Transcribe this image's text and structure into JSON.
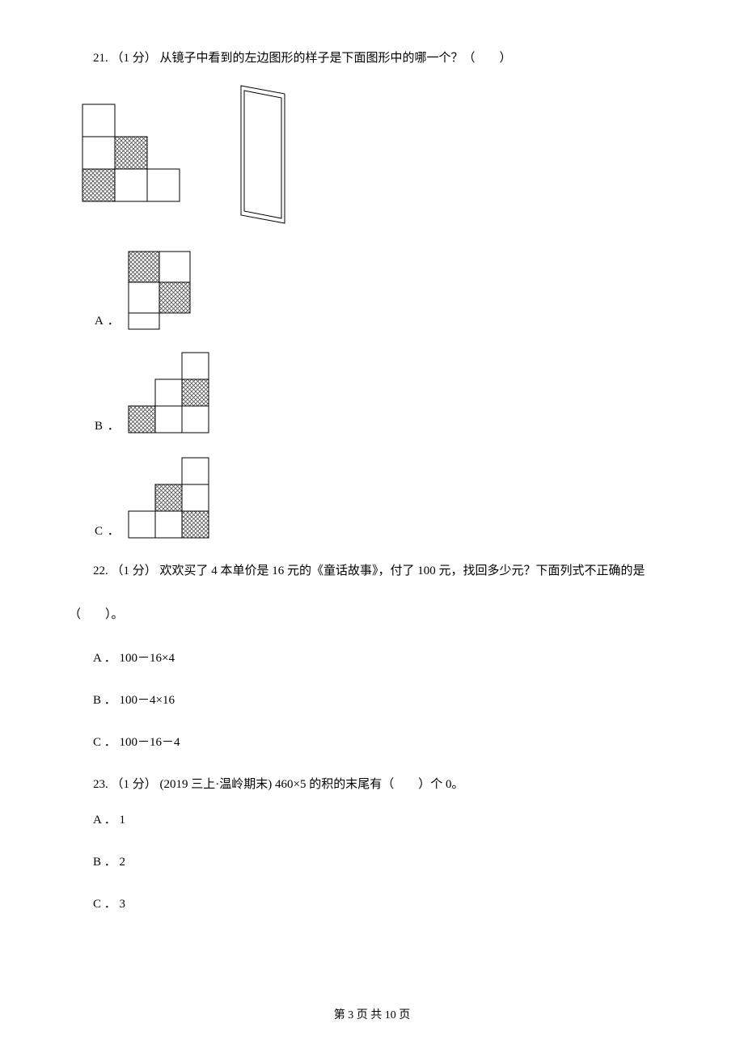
{
  "q21": {
    "number": "21.",
    "points": "（1 分）",
    "text": "从镜子中看到的左边图形的样子是下面图形中的哪一个？（　　）",
    "options": {
      "A": "A ．",
      "B": "B ．",
      "C": "C ．"
    }
  },
  "q22": {
    "number": "22.",
    "points": "（1 分）",
    "text_line1": "欢欢买了 4 本单价是 16 元的《童话故事》，付了 100 元，找回多少元？下面列式不正确的是",
    "text_line2": "（　　）。",
    "options": {
      "A": "A ． 100－16×4",
      "B": "B ． 100－4×16",
      "C": "C ． 100－16－4"
    }
  },
  "q23": {
    "number": "23.",
    "points": "（1 分）",
    "source": "(2019 三上·温岭期末)",
    "text": "460×5 的积的末尾有（　　）个 0。",
    "options": {
      "A": "A ． 1",
      "B": "B ． 2",
      "C": "C ． 3"
    }
  },
  "footer": "第 3 页 共 10 页"
}
